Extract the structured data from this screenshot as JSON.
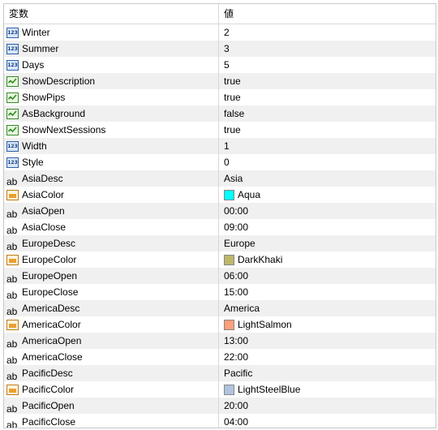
{
  "header": {
    "name_col": "変数",
    "value_col": "値"
  },
  "rows": [
    {
      "name": "Winter",
      "value": "2",
      "type": "int"
    },
    {
      "name": "Summer",
      "value": "3",
      "type": "int"
    },
    {
      "name": "Days",
      "value": "5",
      "type": "int"
    },
    {
      "name": "ShowDescription",
      "value": "true",
      "type": "bool"
    },
    {
      "name": "ShowPips",
      "value": "true",
      "type": "bool"
    },
    {
      "name": "AsBackground",
      "value": "false",
      "type": "bool"
    },
    {
      "name": "ShowNextSessions",
      "value": "true",
      "type": "bool"
    },
    {
      "name": "Width",
      "value": "1",
      "type": "int"
    },
    {
      "name": "Style",
      "value": "0",
      "type": "int"
    },
    {
      "name": "AsiaDesc",
      "value": "Asia",
      "type": "string"
    },
    {
      "name": "AsiaColor",
      "value": "Aqua",
      "type": "color",
      "color": "#00ffff"
    },
    {
      "name": "AsiaOpen",
      "value": "00:00",
      "type": "string"
    },
    {
      "name": "AsiaClose",
      "value": "09:00",
      "type": "string"
    },
    {
      "name": "EuropeDesc",
      "value": "Europe",
      "type": "string"
    },
    {
      "name": "EuropeColor",
      "value": "DarkKhaki",
      "type": "color",
      "color": "#bdb76b"
    },
    {
      "name": "EuropeOpen",
      "value": "06:00",
      "type": "string"
    },
    {
      "name": "EuropeClose",
      "value": "15:00",
      "type": "string"
    },
    {
      "name": "AmericaDesc",
      "value": "America",
      "type": "string"
    },
    {
      "name": "AmericaColor",
      "value": "LightSalmon",
      "type": "color",
      "color": "#ffa07a"
    },
    {
      "name": "AmericaOpen",
      "value": "13:00",
      "type": "string"
    },
    {
      "name": "AmericaClose",
      "value": "22:00",
      "type": "string"
    },
    {
      "name": "PacificDesc",
      "value": "Pacific",
      "type": "string"
    },
    {
      "name": "PacificColor",
      "value": "LightSteelBlue",
      "type": "color",
      "color": "#b0c4de"
    },
    {
      "name": "PacificOpen",
      "value": "20:00",
      "type": "string"
    },
    {
      "name": "PacificClose",
      "value": "04:00",
      "type": "string"
    }
  ]
}
